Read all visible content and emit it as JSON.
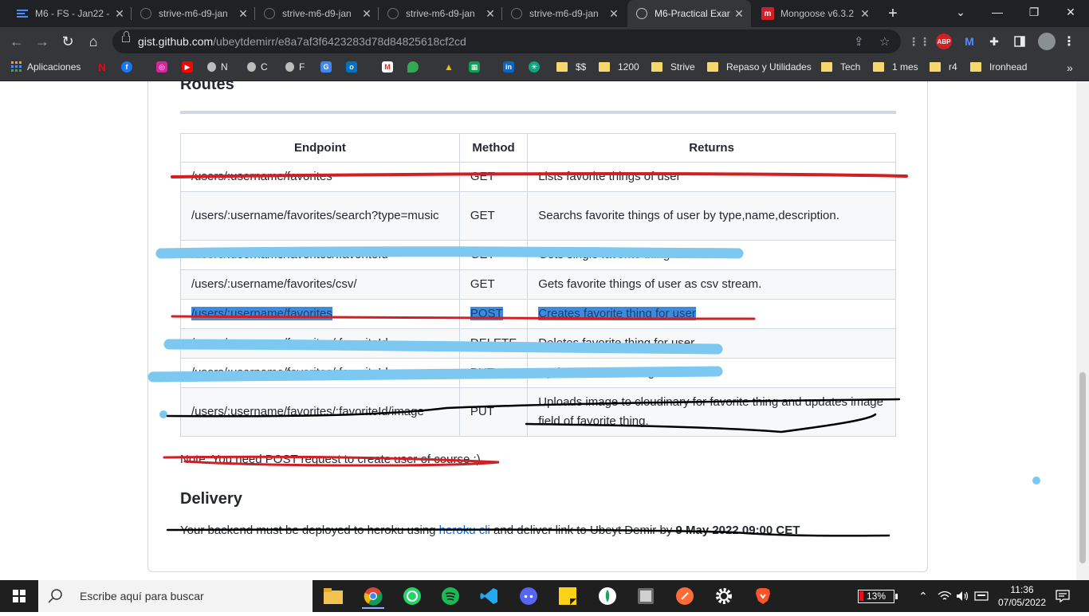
{
  "browser": {
    "tabs": [
      {
        "title": "M6 - FS - Jan22 -",
        "close": "✕"
      },
      {
        "title": "strive-m6-d9-jan",
        "close": "✕"
      },
      {
        "title": "strive-m6-d9-jan",
        "close": "✕"
      },
      {
        "title": "strive-m6-d9-jan",
        "close": "✕"
      },
      {
        "title": "strive-m6-d9-jan",
        "close": "✕"
      },
      {
        "title": "M6-Practical Exar",
        "close": "✕",
        "active": true
      },
      {
        "title": "Mongoose v6.3.2",
        "close": "✕"
      }
    ],
    "new_tab": "+",
    "url_host": "gist.github.com",
    "url_path": "/ubeytdemirr/e8a7af3f6423283d78d84825618cf2cd",
    "extensions": {
      "abp": "ABP"
    },
    "bookmarks": [
      {
        "label": "Aplicaciones"
      },
      {
        "label": ""
      },
      {
        "label": ""
      },
      {
        "label": ""
      },
      {
        "label": ""
      },
      {
        "label": "N"
      },
      {
        "label": "C"
      },
      {
        "label": "F"
      },
      {
        "label": ""
      },
      {
        "label": ""
      },
      {
        "label": ""
      },
      {
        "label": ""
      },
      {
        "label": ""
      },
      {
        "label": ""
      },
      {
        "label": ""
      },
      {
        "label": ""
      },
      {
        "label": "$$"
      },
      {
        "label": "1200"
      },
      {
        "label": "Strive"
      },
      {
        "label": "Repaso y Utilidades"
      },
      {
        "label": "Tech"
      },
      {
        "label": "1 mes"
      },
      {
        "label": "r4"
      },
      {
        "label": "Ironhead"
      }
    ],
    "more_bookmarks": "»"
  },
  "page": {
    "routes_heading": "Routes",
    "table": {
      "headers": [
        "Endpoint",
        "Method",
        "Returns"
      ],
      "rows": [
        {
          "endpoint": "/users/:username/favorites",
          "method": "GET",
          "returns": "Lists favorite things of user"
        },
        {
          "endpoint": "/users/:username/favorites/search?type=music",
          "method": "GET",
          "returns": "Searchs favorite things of user by type,name,description."
        },
        {
          "endpoint": "/users/:username/favorites/:favoriteId",
          "method": "GET",
          "returns": "Gets single favorite thing of user"
        },
        {
          "endpoint": "/users/:username/favorites/csv/",
          "method": "GET",
          "returns": "Gets favorite things of user as csv stream."
        },
        {
          "endpoint": "/users/:username/favorites",
          "method": "POST",
          "returns": "Creates favorite thing for user"
        },
        {
          "endpoint": "/users/:username/favorites/:favoriteId",
          "method": "DELETE",
          "returns": "Deletes favorite thing for user"
        },
        {
          "endpoint": "/users/:username/favorites/:favoriteId",
          "method": "PUT",
          "returns": "Updates favorite thing for user"
        },
        {
          "endpoint": "/users/:username/favorites/:favoriteId/image",
          "method": "PUT",
          "returns": "Uploads image to cloudinary for favorite thing and updates image field of favorite thing."
        }
      ]
    },
    "note": "Note: You need POST request to create user of course :)",
    "delivery_heading": "Delivery",
    "delivery_before": "Your backend must be deployed to heroku using ",
    "delivery_link": "heroku cli",
    "delivery_after": " and deliver link to Ubeyt Demir by ",
    "delivery_deadline": "9 May 2022 09:00 CET"
  },
  "taskbar": {
    "search_placeholder": "Escribe aquí para buscar",
    "battery": "13%",
    "time": "11:36",
    "date": "07/05/2022"
  },
  "colors": {
    "accent_link": "#0969da",
    "selection": "#3b8be0",
    "annotation_red": "#d11f26",
    "annotation_blue": "#7cc8f0",
    "annotation_black": "#000000"
  }
}
